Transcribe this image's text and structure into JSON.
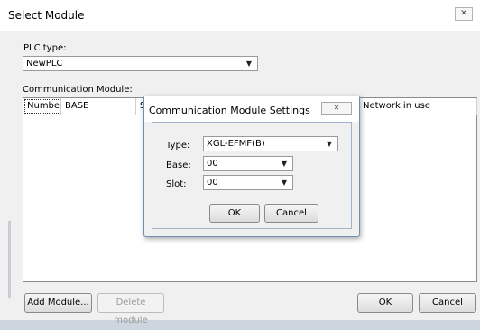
{
  "window": {
    "title": "Select Module",
    "close_glyph": "✕"
  },
  "plc": {
    "label": "PLC type:",
    "value": "NewPLC"
  },
  "comm": {
    "label": "Communication Module:",
    "columns": [
      "Number",
      "BASE",
      "Sl",
      "Network in use"
    ]
  },
  "buttons": {
    "add": "Add Module...",
    "delete": "Delete module",
    "ok": "OK",
    "cancel": "Cancel"
  },
  "dialog": {
    "title": "Communication Module Settings",
    "close_glyph": "✕",
    "type_label": "Type:",
    "type_value": "XGL-EFMF(B)",
    "base_label": "Base:",
    "base_value": "00",
    "slot_label": "Slot:",
    "slot_value": "00",
    "ok": "OK",
    "cancel": "Cancel"
  },
  "icons": {
    "dropdown": "▼"
  }
}
